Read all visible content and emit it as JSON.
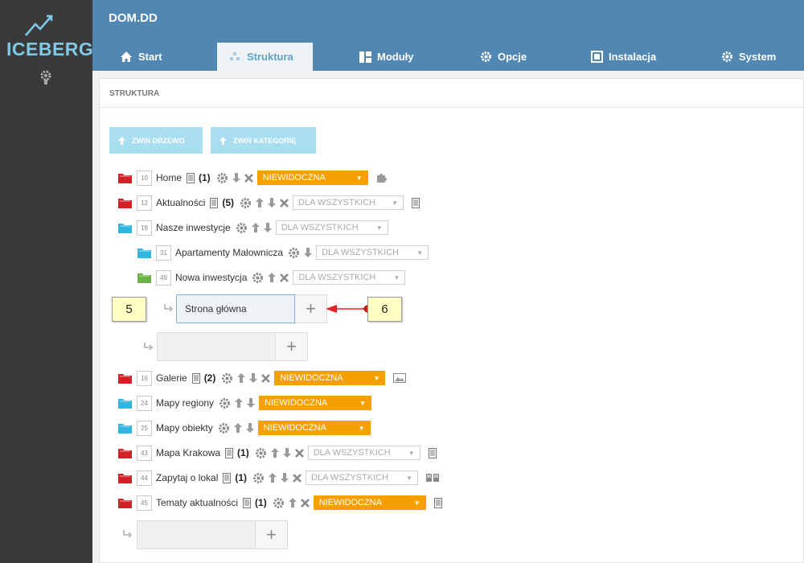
{
  "app": {
    "logo_text": "ICEBERG",
    "site_name": "DOM.DD"
  },
  "tabs": [
    {
      "label": "Start",
      "icon": "home-icon"
    },
    {
      "label": "Struktura",
      "icon": "structure-icon"
    },
    {
      "label": "Moduły",
      "icon": "modules-icon"
    },
    {
      "label": "Opcje",
      "icon": "gear-icon"
    },
    {
      "label": "Instalacja",
      "icon": "installation-icon"
    },
    {
      "label": "System",
      "icon": "gear-icon"
    }
  ],
  "panel": {
    "title": "STRUKTURA",
    "collapse_tree_label": "ZWIŃ DRZEWO",
    "collapse_category_label": "ZWIŃ KATEGORIĘ"
  },
  "tree": [
    {
      "id": "10",
      "name": "Home",
      "count": "(1)",
      "visibility": "NIEWIDOCZNA",
      "folder": "red"
    },
    {
      "id": "12",
      "name": "Aktualności",
      "count": "(5)",
      "visibility": "DLA WSZYSTKICH",
      "folder": "red"
    },
    {
      "id": "18",
      "name": "Nasze inwestycje",
      "count": "",
      "visibility": "DLA WSZYSTKICH",
      "folder": "blue"
    },
    {
      "id": "31",
      "name": "Apartamenty Malownicza",
      "count": "",
      "visibility": "DLA WSZYSTKICH",
      "folder": "blue"
    },
    {
      "id": "49",
      "name": "Nowa inwestycja",
      "count": "",
      "visibility": "DLA WSZYSTKICH",
      "folder": "green"
    },
    {
      "id": "16",
      "name": "Galerie",
      "count": "(2)",
      "visibility": "NIEWIDOCZNA",
      "folder": "red"
    },
    {
      "id": "24",
      "name": "Mapy regiony",
      "count": "",
      "visibility": "NIEWIDOCZNA",
      "folder": "blue"
    },
    {
      "id": "25",
      "name": "Mapy obiekty",
      "count": "",
      "visibility": "NIEWIDOCZNA",
      "folder": "blue"
    },
    {
      "id": "43",
      "name": "Mapa Krakowa",
      "count": "(1)",
      "visibility": "DLA WSZYSTKICH",
      "folder": "red"
    },
    {
      "id": "44",
      "name": "Zapytaj o lokal",
      "count": "(1)",
      "visibility": "DLA WSZYSTKICH",
      "folder": "red"
    },
    {
      "id": "45",
      "name": "Tematy aktualności",
      "count": "(1)",
      "visibility": "NIEWIDOCZNA",
      "folder": "red"
    }
  ],
  "new_item_input": {
    "value": "Strona główna"
  },
  "callouts": {
    "left": "5",
    "right": "6"
  },
  "colors": {
    "accent": "#5087b3",
    "orange": "#f5a000",
    "callout": "#ffffc6",
    "arrow": "#e02020"
  }
}
